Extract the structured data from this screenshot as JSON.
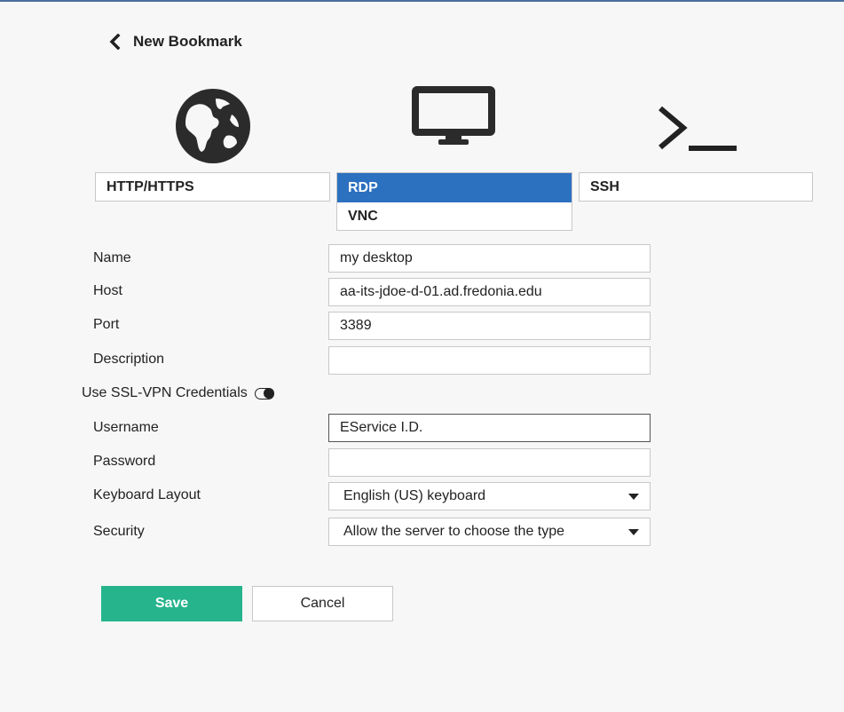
{
  "header": {
    "title": "New Bookmark"
  },
  "types": {
    "http_label": "HTTP/HTTPS",
    "ssh_label": "SSH",
    "dropdown_options": [
      "RDP",
      "VNC"
    ],
    "selected": "RDP"
  },
  "icons": {
    "back": "chevron-left-icon",
    "http": "globe-icon",
    "rdp": "monitor-icon",
    "ssh": "terminal-prompt-icon"
  },
  "form": {
    "name": {
      "label": "Name",
      "value": "my desktop"
    },
    "host": {
      "label": "Host",
      "value": "aa-its-jdoe-d-01.ad.fredonia.edu"
    },
    "port": {
      "label": "Port",
      "value": "3389"
    },
    "description": {
      "label": "Description",
      "value": ""
    },
    "ssl_vpn": {
      "label": "Use SSL-VPN Credentials",
      "enabled": false
    },
    "username": {
      "label": "Username",
      "value": "EService I.D."
    },
    "password": {
      "label": "Password",
      "value": ""
    },
    "keyboard_layout": {
      "label": "Keyboard Layout",
      "value": "English (US) keyboard"
    },
    "security": {
      "label": "Security",
      "value": "Allow the server to choose the type"
    }
  },
  "buttons": {
    "save": "Save",
    "cancel": "Cancel"
  },
  "colors": {
    "accent_selected": "#2c70c0",
    "save_button": "#26b48c",
    "top_line": "#4a6f9c"
  }
}
